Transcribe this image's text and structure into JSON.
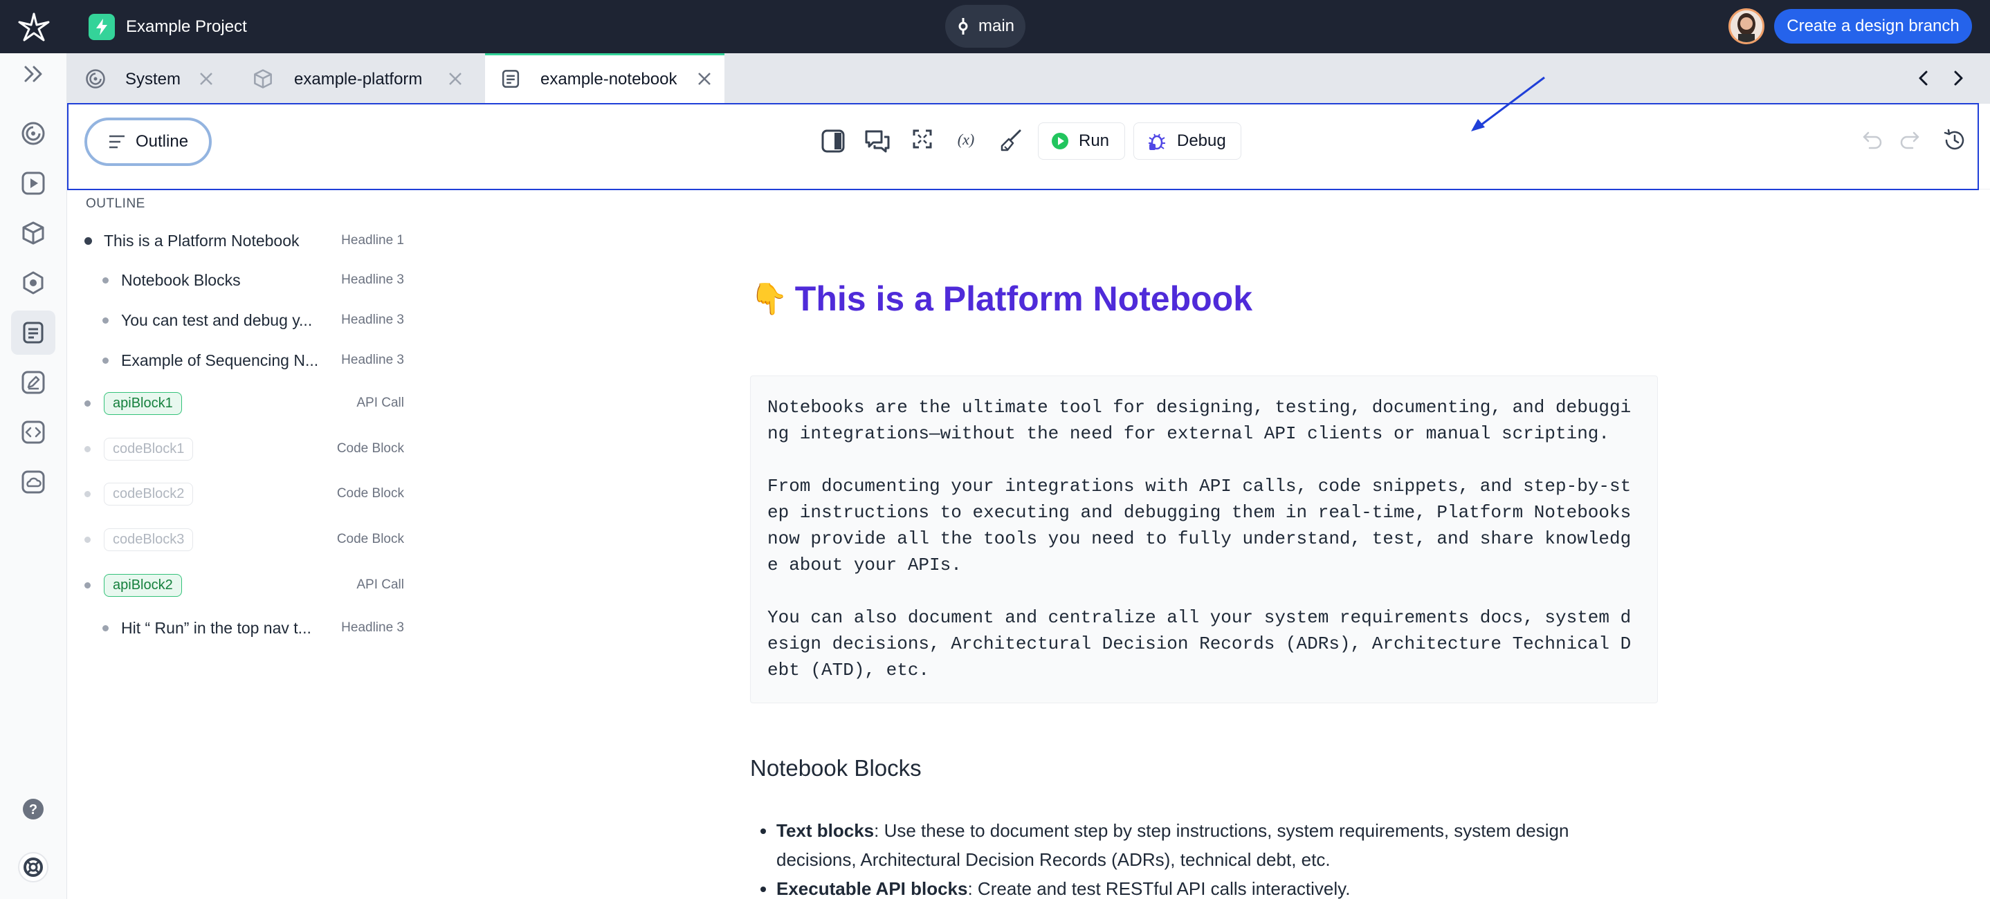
{
  "topbar": {
    "project_name": "Example Project",
    "branch_name": "main",
    "create_branch_label": "Create a design branch"
  },
  "tabs": [
    {
      "label": "System"
    },
    {
      "label": "example-platform"
    },
    {
      "label": "example-notebook"
    }
  ],
  "toolbar": {
    "outline_label": "Outline",
    "run_label": "Run",
    "debug_label": "Debug"
  },
  "outline": {
    "heading": "OUTLINE",
    "items": [
      {
        "label": "This is a Platform Notebook",
        "type": "Headline 1"
      },
      {
        "label": "Notebook Blocks",
        "type": "Headline 3"
      },
      {
        "label": "You can test and debug y...",
        "type": "Headline 3"
      },
      {
        "label": "Example of Sequencing N...",
        "type": "Headline 3"
      },
      {
        "label": "apiBlock1",
        "type": "API Call"
      },
      {
        "label": "codeBlock1",
        "type": "Code Block"
      },
      {
        "label": "codeBlock2",
        "type": "Code Block"
      },
      {
        "label": "codeBlock3",
        "type": "Code Block"
      },
      {
        "label": "apiBlock2",
        "type": "API Call"
      },
      {
        "label": "Hit “ Run” in the top nav t...",
        "type": "Headline 3"
      }
    ]
  },
  "document": {
    "title_emoji": "👇",
    "title": "This is a Platform Notebook",
    "paragraphs": [
      "Notebooks are the ultimate tool for designing, testing, documenting, and debugging integrations—without the need for external API clients or manual scripting.",
      "From documenting your integrations with API calls, code snippets, and step-by-step instructions to executing and debugging them in real-time, Platform Notebooks now provide all the tools you need to fully understand, test, and share knowledge about your APIs.",
      "You can also document and centralize all your system requirements docs, system design decisions, Architectural Decision Records (ADRs), Architecture Technical Debt (ATD), etc."
    ],
    "section_heading": "Notebook Blocks",
    "bullets": [
      {
        "bold": "Text blocks",
        "text": ": Use these to document step by step instructions, system requirements, system design decisions, Architectural Decision Records (ADRs), technical debt, etc."
      },
      {
        "bold": "Executable API blocks",
        "text": ": Create and test RESTful API calls interactively."
      }
    ]
  }
}
